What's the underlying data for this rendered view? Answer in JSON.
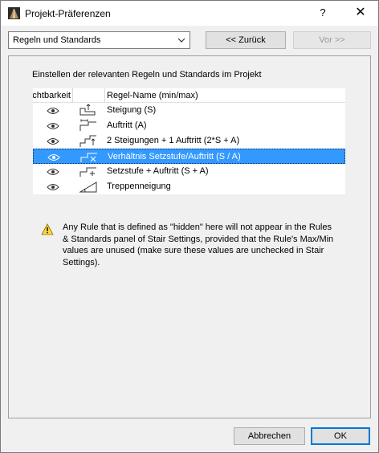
{
  "window": {
    "title": "Projekt-Präferenzen",
    "help": "?",
    "close": "✕"
  },
  "toolbar": {
    "dropdown_value": "Regeln und Standards",
    "back_label": "<< Zurück",
    "next_label": "Vor >>"
  },
  "panel": {
    "description": "Einstellen der relevanten Regeln und Standards im Projekt",
    "table": {
      "col_visibility": "Sichtbarkeit",
      "col_name": "Regel-Name (min/max)",
      "rows": [
        {
          "name": "Steigung (S)",
          "icon": "riser-icon",
          "selected": false
        },
        {
          "name": "Auftritt (A)",
          "icon": "tread-icon",
          "selected": false
        },
        {
          "name": "2 Steigungen + 1 Auftritt (2*S + A)",
          "icon": "step-formula-icon",
          "selected": false
        },
        {
          "name": "Verhältnis Setzstufe/Auftritt (S / A)",
          "icon": "ratio-icon",
          "selected": true
        },
        {
          "name": "Setzstufe + Auftritt (S + A)",
          "icon": "sum-icon",
          "selected": false
        },
        {
          "name": "Treppenneigung",
          "icon": "pitch-icon",
          "selected": false
        }
      ]
    },
    "warning": "Any Rule that is defined as \"hidden\" here will not appear in the Rules & Standards panel of Stair Settings, provided that the Rule's Max/Min values are unused (make sure these values are unchecked in Stair Settings)."
  },
  "footer": {
    "cancel_label": "Abbrechen",
    "ok_label": "OK"
  }
}
